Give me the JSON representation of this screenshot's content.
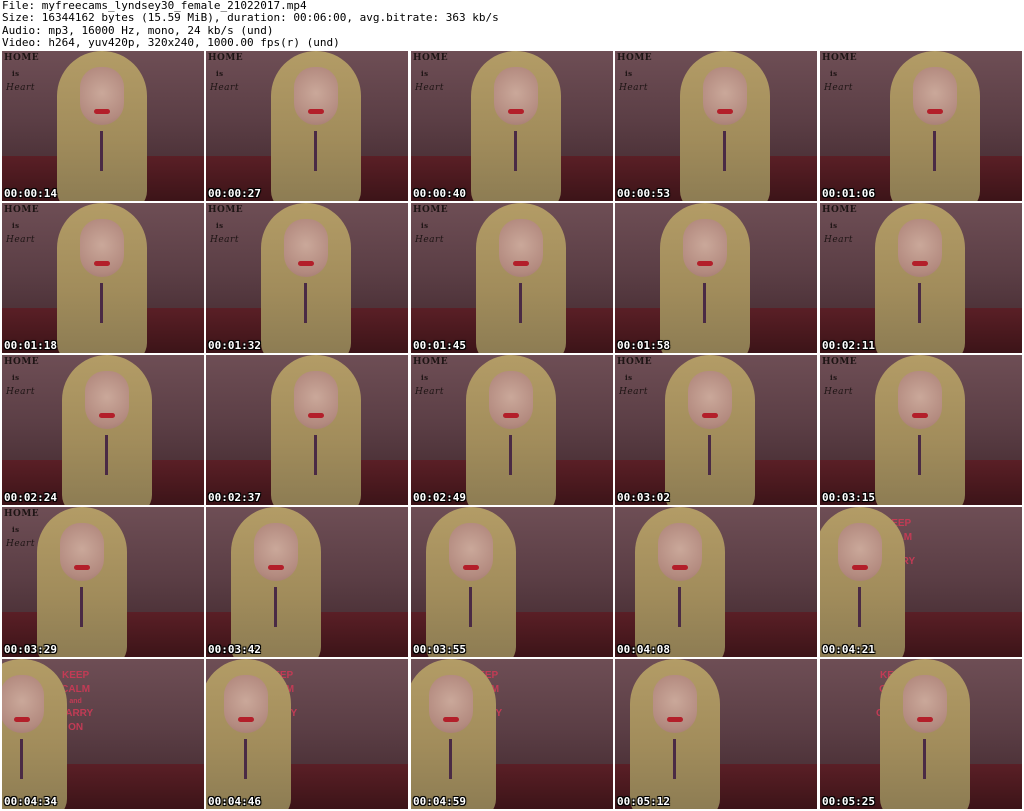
{
  "header": {
    "line1": "File: myfreecams_lyndsey30_female_21022017.mp4",
    "line2": "Size: 16344162 bytes (15.59 MiB), duration: 00:06:00, avg.bitrate: 363 kb/s",
    "line3": "Audio: mp3, 16000 Hz, mono, 24 kb/s (und)",
    "line4": "Video: h264, yuv420p, 320x240, 1000.00 fps(r) (und)"
  },
  "thumbnails": [
    {
      "timestamp": "00:00:14",
      "scene": "home"
    },
    {
      "timestamp": "00:00:27",
      "scene": "home"
    },
    {
      "timestamp": "00:00:40",
      "scene": "home"
    },
    {
      "timestamp": "00:00:53",
      "scene": "home"
    },
    {
      "timestamp": "00:01:06",
      "scene": "home"
    },
    {
      "timestamp": "00:01:18",
      "scene": "home"
    },
    {
      "timestamp": "00:01:32",
      "scene": "home"
    },
    {
      "timestamp": "00:01:45",
      "scene": "home"
    },
    {
      "timestamp": "00:01:58",
      "scene": "plain"
    },
    {
      "timestamp": "00:02:11",
      "scene": "home"
    },
    {
      "timestamp": "00:02:24",
      "scene": "home"
    },
    {
      "timestamp": "00:02:37",
      "scene": "plain"
    },
    {
      "timestamp": "00:02:49",
      "scene": "home"
    },
    {
      "timestamp": "00:03:02",
      "scene": "home"
    },
    {
      "timestamp": "00:03:15",
      "scene": "home"
    },
    {
      "timestamp": "00:03:29",
      "scene": "home"
    },
    {
      "timestamp": "00:03:42",
      "scene": "plain"
    },
    {
      "timestamp": "00:03:55",
      "scene": "plain"
    },
    {
      "timestamp": "00:04:08",
      "scene": "plain"
    },
    {
      "timestamp": "00:04:21",
      "scene": "poster"
    },
    {
      "timestamp": "00:04:34",
      "scene": "poster"
    },
    {
      "timestamp": "00:04:46",
      "scene": "poster"
    },
    {
      "timestamp": "00:04:59",
      "scene": "poster"
    },
    {
      "timestamp": "00:05:12",
      "scene": "poster"
    },
    {
      "timestamp": "00:05:25",
      "scene": "poster"
    }
  ],
  "wall_text": {
    "home": "HOME",
    "is": "is",
    "heart": "Heart"
  },
  "poster_text": [
    "KEEP",
    "CALM",
    "and",
    "CARRY",
    "ON"
  ],
  "colors": {
    "timestamp_text": "#ffffff",
    "timestamp_outline": "#000000",
    "page_background": "#ffffff"
  }
}
